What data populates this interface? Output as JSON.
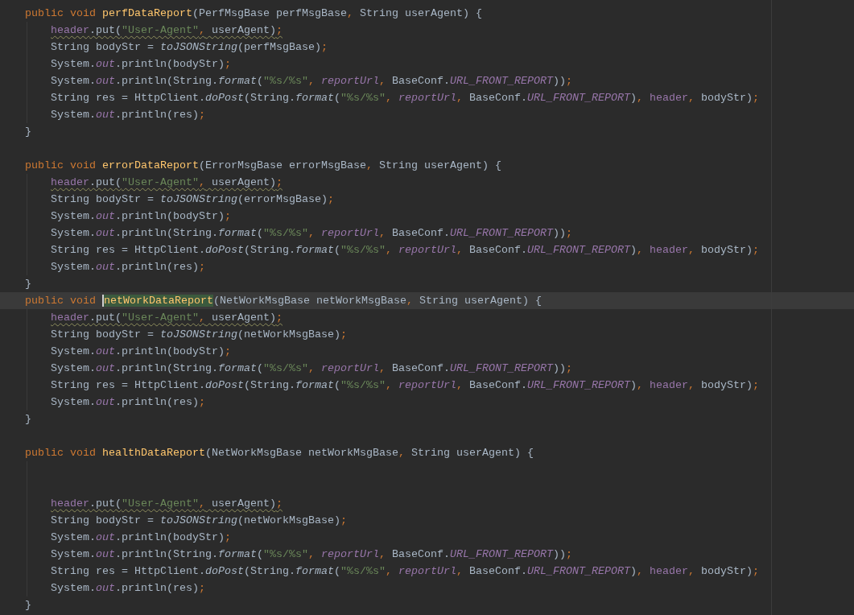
{
  "lines": [
    {
      "kind": "method",
      "current": false,
      "signature": [
        {
          "text": "public void ",
          "kind": "kw"
        },
        {
          "text": "perfDataReport",
          "kind": "decl",
          "highlighted": false,
          "caret": false
        },
        {
          "text": "(PerfMsgBase perfMsgBase",
          "kind": "plain"
        },
        {
          "text": ",",
          "kind": "punc"
        },
        {
          "text": " String userAgent) {",
          "kind": "plain"
        }
      ],
      "body": [
        {
          "kind": "statement",
          "warning": true,
          "tokens": [
            {
              "text": "header",
              "kind": "field"
            },
            {
              "text": ".put(",
              "kind": "plain"
            },
            {
              "text": "\"User-Agent\"",
              "kind": "str"
            },
            {
              "text": ",",
              "kind": "punc"
            },
            {
              "text": " userAgent)",
              "kind": "plain"
            },
            {
              "text": ";",
              "kind": "punc"
            }
          ]
        },
        {
          "kind": "statement",
          "warning": false,
          "tokens": [
            {
              "text": "String bodyStr = ",
              "kind": "plain"
            },
            {
              "text": "toJSONString",
              "kind": "smethod"
            },
            {
              "text": "(perfMsgBase)",
              "kind": "plain"
            },
            {
              "text": ";",
              "kind": "punc"
            }
          ]
        },
        {
          "kind": "statement",
          "warning": false,
          "tokens": [
            {
              "text": "System.",
              "kind": "plain"
            },
            {
              "text": "out",
              "kind": "sfield"
            },
            {
              "text": ".println(bodyStr)",
              "kind": "plain"
            },
            {
              "text": ";",
              "kind": "punc"
            }
          ]
        },
        {
          "kind": "statement",
          "warning": false,
          "tokens": [
            {
              "text": "System.",
              "kind": "plain"
            },
            {
              "text": "out",
              "kind": "sfield"
            },
            {
              "text": ".println(String.",
              "kind": "plain"
            },
            {
              "text": "format",
              "kind": "smethod"
            },
            {
              "text": "(",
              "kind": "plain"
            },
            {
              "text": "\"%s/%s\"",
              "kind": "str"
            },
            {
              "text": ",",
              "kind": "punc"
            },
            {
              "text": " reportUrl",
              "kind": "sfield"
            },
            {
              "text": ",",
              "kind": "punc"
            },
            {
              "text": " BaseConf.",
              "kind": "plain"
            },
            {
              "text": "URL_FRONT_REPORT",
              "kind": "sfield"
            },
            {
              "text": "))",
              "kind": "plain"
            },
            {
              "text": ";",
              "kind": "punc"
            }
          ]
        },
        {
          "kind": "statement",
          "warning": false,
          "tokens": [
            {
              "text": "String res = HttpClient.",
              "kind": "plain"
            },
            {
              "text": "doPost",
              "kind": "smethod"
            },
            {
              "text": "(String.",
              "kind": "plain"
            },
            {
              "text": "format",
              "kind": "smethod"
            },
            {
              "text": "(",
              "kind": "plain"
            },
            {
              "text": "\"%s/%s\"",
              "kind": "str"
            },
            {
              "text": ",",
              "kind": "punc"
            },
            {
              "text": " reportUrl",
              "kind": "sfield"
            },
            {
              "text": ",",
              "kind": "punc"
            },
            {
              "text": " BaseConf.",
              "kind": "plain"
            },
            {
              "text": "URL_FRONT_REPORT",
              "kind": "sfield"
            },
            {
              "text": ")",
              "kind": "plain"
            },
            {
              "text": ",",
              "kind": "punc"
            },
            {
              "text": " header",
              "kind": "field"
            },
            {
              "text": ",",
              "kind": "punc"
            },
            {
              "text": " bodyStr)",
              "kind": "plain"
            },
            {
              "text": ";",
              "kind": "punc"
            }
          ]
        },
        {
          "kind": "statement",
          "warning": false,
          "tokens": [
            {
              "text": "System.",
              "kind": "plain"
            },
            {
              "text": "out",
              "kind": "sfield"
            },
            {
              "text": ".println(res)",
              "kind": "plain"
            },
            {
              "text": ";",
              "kind": "punc"
            }
          ]
        }
      ],
      "close": "}"
    },
    {
      "kind": "blank"
    },
    {
      "kind": "method",
      "current": false,
      "signature": [
        {
          "text": "public void ",
          "kind": "kw"
        },
        {
          "text": "errorDataReport",
          "kind": "decl",
          "highlighted": false,
          "caret": false
        },
        {
          "text": "(ErrorMsgBase errorMsgBase",
          "kind": "plain"
        },
        {
          "text": ",",
          "kind": "punc"
        },
        {
          "text": " String userAgent) {",
          "kind": "plain"
        }
      ],
      "body": [
        {
          "kind": "statement",
          "warning": true,
          "tokens": [
            {
              "text": "header",
              "kind": "field"
            },
            {
              "text": ".put(",
              "kind": "plain"
            },
            {
              "text": "\"User-Agent\"",
              "kind": "str"
            },
            {
              "text": ",",
              "kind": "punc"
            },
            {
              "text": " userAgent)",
              "kind": "plain"
            },
            {
              "text": ";",
              "kind": "punc"
            }
          ]
        },
        {
          "kind": "statement",
          "warning": false,
          "tokens": [
            {
              "text": "String bodyStr = ",
              "kind": "plain"
            },
            {
              "text": "toJSONString",
              "kind": "smethod"
            },
            {
              "text": "(errorMsgBase)",
              "kind": "plain"
            },
            {
              "text": ";",
              "kind": "punc"
            }
          ]
        },
        {
          "kind": "statement",
          "warning": false,
          "tokens": [
            {
              "text": "System.",
              "kind": "plain"
            },
            {
              "text": "out",
              "kind": "sfield"
            },
            {
              "text": ".println(bodyStr)",
              "kind": "plain"
            },
            {
              "text": ";",
              "kind": "punc"
            }
          ]
        },
        {
          "kind": "statement",
          "warning": false,
          "tokens": [
            {
              "text": "System.",
              "kind": "plain"
            },
            {
              "text": "out",
              "kind": "sfield"
            },
            {
              "text": ".println(String.",
              "kind": "plain"
            },
            {
              "text": "format",
              "kind": "smethod"
            },
            {
              "text": "(",
              "kind": "plain"
            },
            {
              "text": "\"%s/%s\"",
              "kind": "str"
            },
            {
              "text": ",",
              "kind": "punc"
            },
            {
              "text": " reportUrl",
              "kind": "sfield"
            },
            {
              "text": ",",
              "kind": "punc"
            },
            {
              "text": " BaseConf.",
              "kind": "plain"
            },
            {
              "text": "URL_FRONT_REPORT",
              "kind": "sfield"
            },
            {
              "text": "))",
              "kind": "plain"
            },
            {
              "text": ";",
              "kind": "punc"
            }
          ]
        },
        {
          "kind": "statement",
          "warning": false,
          "tokens": [
            {
              "text": "String res = HttpClient.",
              "kind": "plain"
            },
            {
              "text": "doPost",
              "kind": "smethod"
            },
            {
              "text": "(String.",
              "kind": "plain"
            },
            {
              "text": "format",
              "kind": "smethod"
            },
            {
              "text": "(",
              "kind": "plain"
            },
            {
              "text": "\"%s/%s\"",
              "kind": "str"
            },
            {
              "text": ",",
              "kind": "punc"
            },
            {
              "text": " reportUrl",
              "kind": "sfield"
            },
            {
              "text": ",",
              "kind": "punc"
            },
            {
              "text": " BaseConf.",
              "kind": "plain"
            },
            {
              "text": "URL_FRONT_REPORT",
              "kind": "sfield"
            },
            {
              "text": ")",
              "kind": "plain"
            },
            {
              "text": ",",
              "kind": "punc"
            },
            {
              "text": " header",
              "kind": "field"
            },
            {
              "text": ",",
              "kind": "punc"
            },
            {
              "text": " bodyStr)",
              "kind": "plain"
            },
            {
              "text": ";",
              "kind": "punc"
            }
          ]
        },
        {
          "kind": "statement",
          "warning": false,
          "tokens": [
            {
              "text": "System.",
              "kind": "plain"
            },
            {
              "text": "out",
              "kind": "sfield"
            },
            {
              "text": ".println(res)",
              "kind": "plain"
            },
            {
              "text": ";",
              "kind": "punc"
            }
          ]
        }
      ],
      "close": "}"
    },
    {
      "kind": "method",
      "current": true,
      "signature": [
        {
          "text": "public void ",
          "kind": "kw"
        },
        {
          "text": "netWorkDataReport",
          "kind": "decl",
          "highlighted": true,
          "caret": true
        },
        {
          "text": "(NetWorkMsgBase netWorkMsgBase",
          "kind": "plain"
        },
        {
          "text": ",",
          "kind": "punc"
        },
        {
          "text": " String userAgent) {",
          "kind": "plain"
        }
      ],
      "body": [
        {
          "kind": "statement",
          "warning": true,
          "tokens": [
            {
              "text": "header",
              "kind": "field"
            },
            {
              "text": ".put(",
              "kind": "plain"
            },
            {
              "text": "\"User-Agent\"",
              "kind": "str"
            },
            {
              "text": ",",
              "kind": "punc"
            },
            {
              "text": " userAgent)",
              "kind": "plain"
            },
            {
              "text": ";",
              "kind": "punc"
            }
          ]
        },
        {
          "kind": "statement",
          "warning": false,
          "tokens": [
            {
              "text": "String bodyStr = ",
              "kind": "plain"
            },
            {
              "text": "toJSONString",
              "kind": "smethod"
            },
            {
              "text": "(netWorkMsgBase)",
              "kind": "plain"
            },
            {
              "text": ";",
              "kind": "punc"
            }
          ]
        },
        {
          "kind": "statement",
          "warning": false,
          "tokens": [
            {
              "text": "System.",
              "kind": "plain"
            },
            {
              "text": "out",
              "kind": "sfield"
            },
            {
              "text": ".println(bodyStr)",
              "kind": "plain"
            },
            {
              "text": ";",
              "kind": "punc"
            }
          ]
        },
        {
          "kind": "statement",
          "warning": false,
          "tokens": [
            {
              "text": "System.",
              "kind": "plain"
            },
            {
              "text": "out",
              "kind": "sfield"
            },
            {
              "text": ".println(String.",
              "kind": "plain"
            },
            {
              "text": "format",
              "kind": "smethod"
            },
            {
              "text": "(",
              "kind": "plain"
            },
            {
              "text": "\"%s/%s\"",
              "kind": "str"
            },
            {
              "text": ",",
              "kind": "punc"
            },
            {
              "text": " reportUrl",
              "kind": "sfield"
            },
            {
              "text": ",",
              "kind": "punc"
            },
            {
              "text": " BaseConf.",
              "kind": "plain"
            },
            {
              "text": "URL_FRONT_REPORT",
              "kind": "sfield"
            },
            {
              "text": "))",
              "kind": "plain"
            },
            {
              "text": ";",
              "kind": "punc"
            }
          ]
        },
        {
          "kind": "statement",
          "warning": false,
          "tokens": [
            {
              "text": "String res = HttpClient.",
              "kind": "plain"
            },
            {
              "text": "doPost",
              "kind": "smethod"
            },
            {
              "text": "(String.",
              "kind": "plain"
            },
            {
              "text": "format",
              "kind": "smethod"
            },
            {
              "text": "(",
              "kind": "plain"
            },
            {
              "text": "\"%s/%s\"",
              "kind": "str"
            },
            {
              "text": ",",
              "kind": "punc"
            },
            {
              "text": " reportUrl",
              "kind": "sfield"
            },
            {
              "text": ",",
              "kind": "punc"
            },
            {
              "text": " BaseConf.",
              "kind": "plain"
            },
            {
              "text": "URL_FRONT_REPORT",
              "kind": "sfield"
            },
            {
              "text": ")",
              "kind": "plain"
            },
            {
              "text": ",",
              "kind": "punc"
            },
            {
              "text": " header",
              "kind": "field"
            },
            {
              "text": ",",
              "kind": "punc"
            },
            {
              "text": " bodyStr)",
              "kind": "plain"
            },
            {
              "text": ";",
              "kind": "punc"
            }
          ]
        },
        {
          "kind": "statement",
          "warning": false,
          "tokens": [
            {
              "text": "System.",
              "kind": "plain"
            },
            {
              "text": "out",
              "kind": "sfield"
            },
            {
              "text": ".println(res)",
              "kind": "plain"
            },
            {
              "text": ";",
              "kind": "punc"
            }
          ]
        }
      ],
      "close": "}"
    },
    {
      "kind": "blank"
    },
    {
      "kind": "method",
      "current": false,
      "signature": [
        {
          "text": "public void ",
          "kind": "kw"
        },
        {
          "text": "healthDataReport",
          "kind": "decl",
          "highlighted": false,
          "caret": false
        },
        {
          "text": "(NetWorkMsgBase netWorkMsgBase",
          "kind": "plain"
        },
        {
          "text": ",",
          "kind": "punc"
        },
        {
          "text": " String userAgent) {",
          "kind": "plain"
        }
      ],
      "body": [
        {
          "kind": "blank"
        },
        {
          "kind": "blank"
        },
        {
          "kind": "statement",
          "warning": true,
          "tokens": [
            {
              "text": "header",
              "kind": "field"
            },
            {
              "text": ".put(",
              "kind": "plain"
            },
            {
              "text": "\"User-Agent\"",
              "kind": "str"
            },
            {
              "text": ",",
              "kind": "punc"
            },
            {
              "text": " userAgent)",
              "kind": "plain"
            },
            {
              "text": ";",
              "kind": "punc"
            }
          ]
        },
        {
          "kind": "statement",
          "warning": false,
          "tokens": [
            {
              "text": "String bodyStr = ",
              "kind": "plain"
            },
            {
              "text": "toJSONString",
              "kind": "smethod"
            },
            {
              "text": "(netWorkMsgBase)",
              "kind": "plain"
            },
            {
              "text": ";",
              "kind": "punc"
            }
          ]
        },
        {
          "kind": "statement",
          "warning": false,
          "tokens": [
            {
              "text": "System.",
              "kind": "plain"
            },
            {
              "text": "out",
              "kind": "sfield"
            },
            {
              "text": ".println(bodyStr)",
              "kind": "plain"
            },
            {
              "text": ";",
              "kind": "punc"
            }
          ]
        },
        {
          "kind": "statement",
          "warning": false,
          "tokens": [
            {
              "text": "System.",
              "kind": "plain"
            },
            {
              "text": "out",
              "kind": "sfield"
            },
            {
              "text": ".println(String.",
              "kind": "plain"
            },
            {
              "text": "format",
              "kind": "smethod"
            },
            {
              "text": "(",
              "kind": "plain"
            },
            {
              "text": "\"%s/%s\"",
              "kind": "str"
            },
            {
              "text": ",",
              "kind": "punc"
            },
            {
              "text": " reportUrl",
              "kind": "sfield"
            },
            {
              "text": ",",
              "kind": "punc"
            },
            {
              "text": " BaseConf.",
              "kind": "plain"
            },
            {
              "text": "URL_FRONT_REPORT",
              "kind": "sfield"
            },
            {
              "text": "))",
              "kind": "plain"
            },
            {
              "text": ";",
              "kind": "punc"
            }
          ]
        },
        {
          "kind": "statement",
          "warning": false,
          "tokens": [
            {
              "text": "String res = HttpClient.",
              "kind": "plain"
            },
            {
              "text": "doPost",
              "kind": "smethod"
            },
            {
              "text": "(String.",
              "kind": "plain"
            },
            {
              "text": "format",
              "kind": "smethod"
            },
            {
              "text": "(",
              "kind": "plain"
            },
            {
              "text": "\"%s/%s\"",
              "kind": "str"
            },
            {
              "text": ",",
              "kind": "punc"
            },
            {
              "text": " reportUrl",
              "kind": "sfield"
            },
            {
              "text": ",",
              "kind": "punc"
            },
            {
              "text": " BaseConf.",
              "kind": "plain"
            },
            {
              "text": "URL_FRONT_REPORT",
              "kind": "sfield"
            },
            {
              "text": ")",
              "kind": "plain"
            },
            {
              "text": ",",
              "kind": "punc"
            },
            {
              "text": " header",
              "kind": "field"
            },
            {
              "text": ",",
              "kind": "punc"
            },
            {
              "text": " bodyStr)",
              "kind": "plain"
            },
            {
              "text": ";",
              "kind": "punc"
            }
          ]
        },
        {
          "kind": "statement",
          "warning": false,
          "tokens": [
            {
              "text": "System.",
              "kind": "plain"
            },
            {
              "text": "out",
              "kind": "sfield"
            },
            {
              "text": ".println(res)",
              "kind": "plain"
            },
            {
              "text": ";",
              "kind": "punc"
            }
          ]
        }
      ],
      "close": "}"
    }
  ]
}
